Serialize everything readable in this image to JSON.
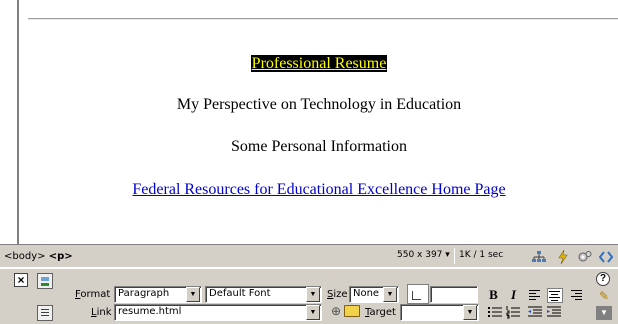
{
  "document": {
    "heading_link": "Professional Resume",
    "line2": "My Perspective on Technology in Education",
    "line3": "Some Personal Information",
    "bottom_link": "Federal Resources for Educational Excellence Home Page"
  },
  "statusbar": {
    "tag_body": "<body>",
    "tag_p": "<p>",
    "window_size": "550 x 397",
    "download_time": "1K / 1 sec",
    "icons": [
      "site-map-icon",
      "lightning-icon",
      "gears-icon",
      "code-brackets-icon"
    ]
  },
  "properties": {
    "format_label": "Format",
    "format_value": "Paragraph",
    "font_value": "Default Font",
    "size_label": "Size",
    "size_value": "None",
    "link_label": "Link",
    "link_value": "resume.html",
    "target_label": "Target",
    "target_value": "",
    "bold_label": "B",
    "italic_label": "I",
    "help_label": "?"
  },
  "colors": {
    "highlight_bg": "#000000",
    "highlight_text": "#ffff00",
    "link": "#0000cc",
    "panel": "#d4d0c8"
  }
}
